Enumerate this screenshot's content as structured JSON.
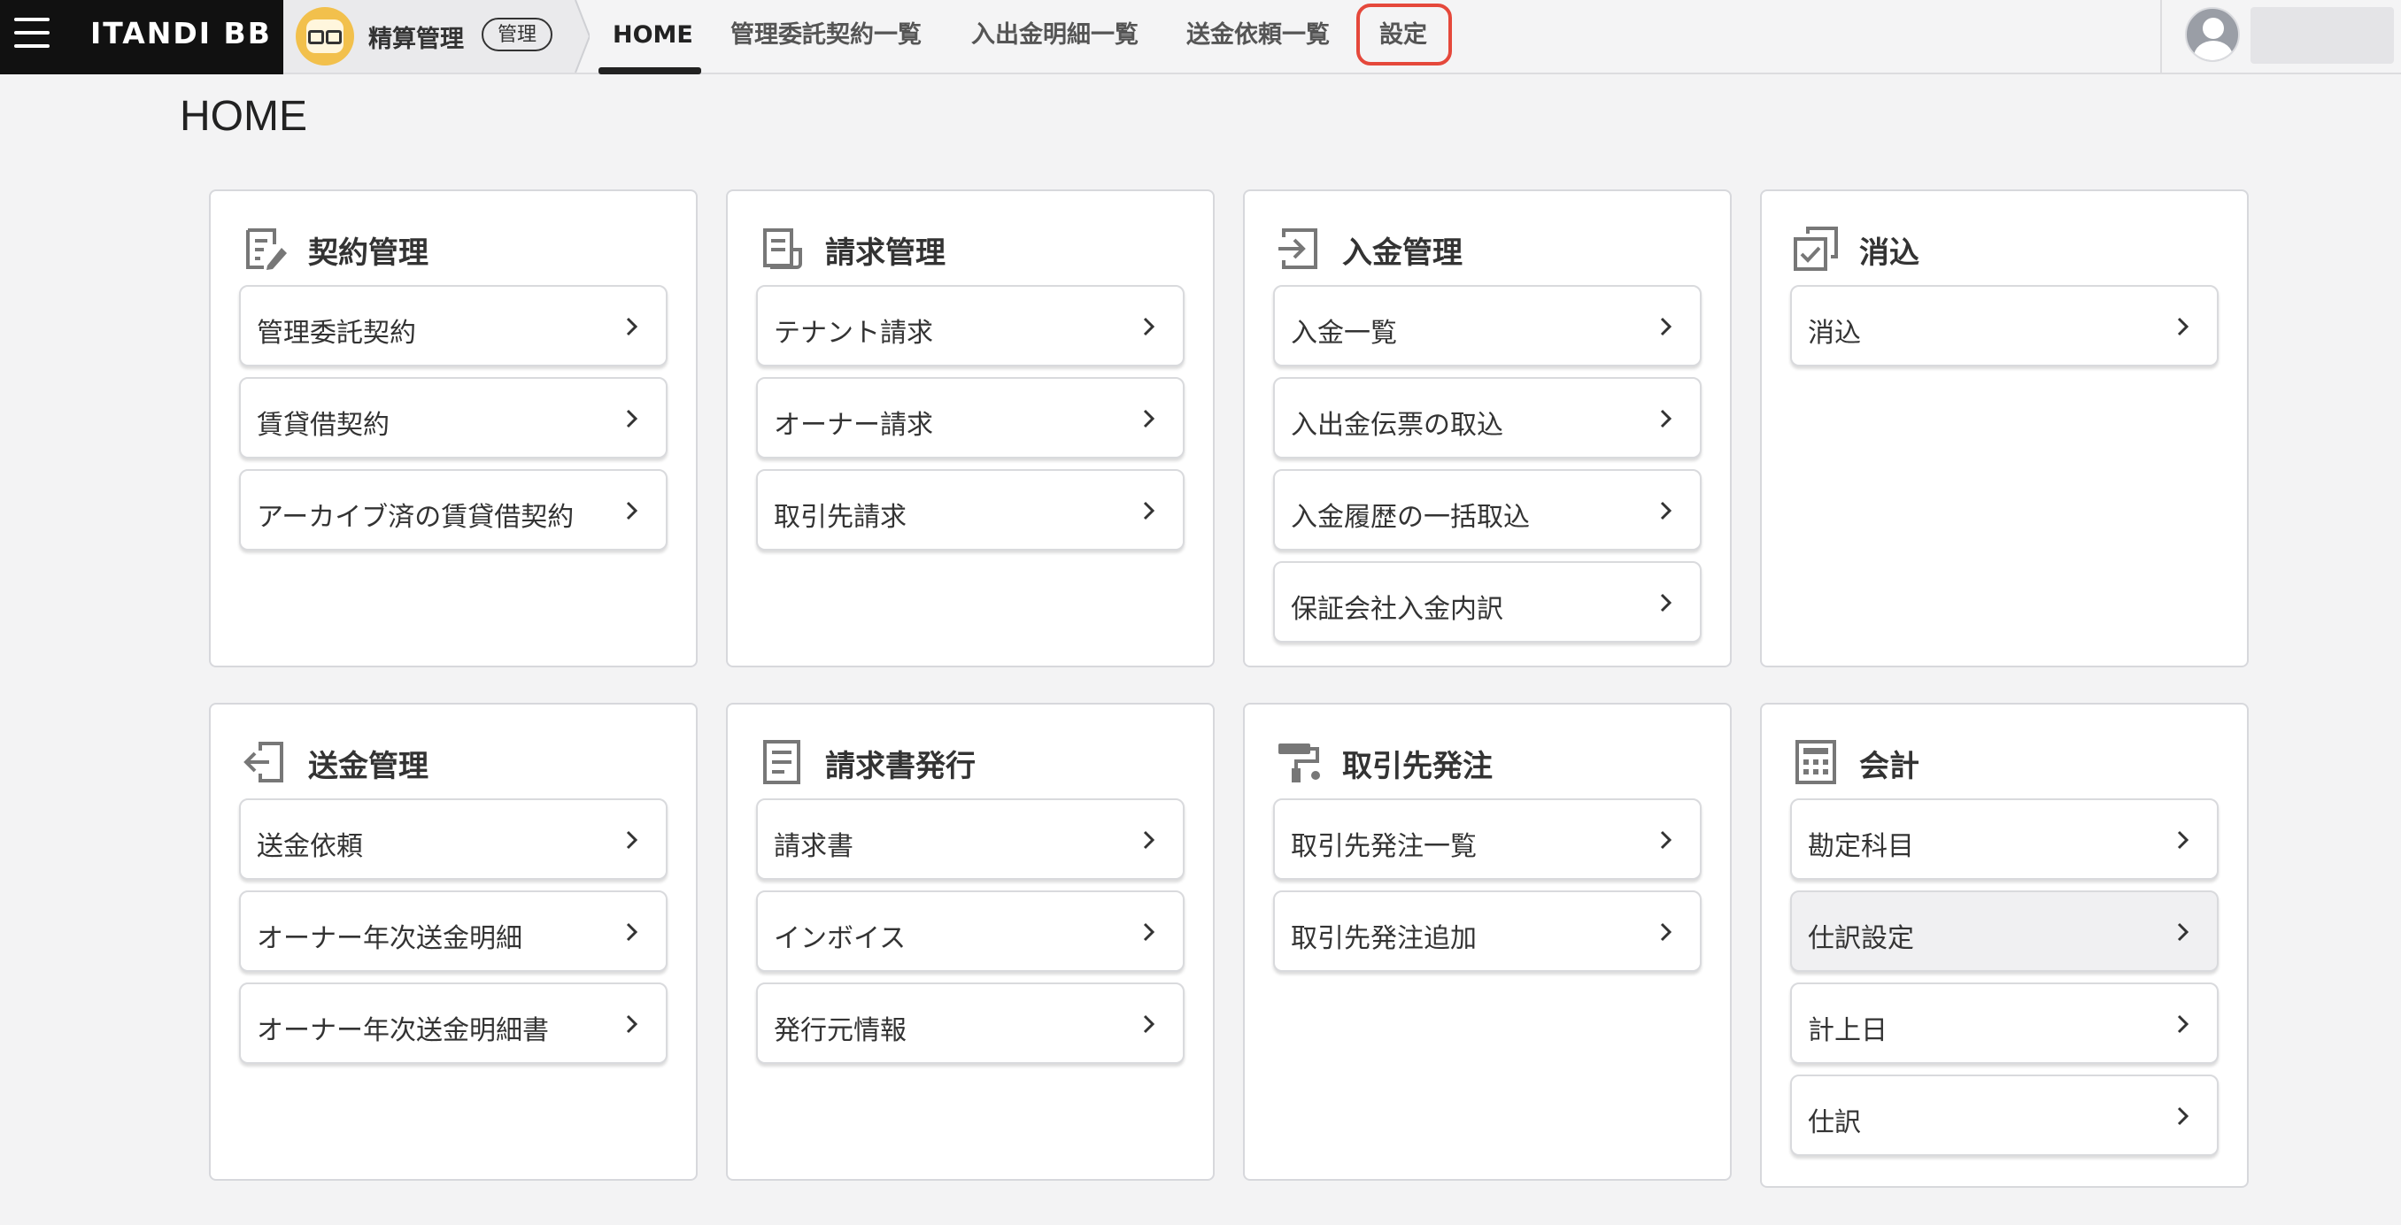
{
  "header": {
    "logo": "ITANDI BB",
    "app_name": "精算管理",
    "app_badge": "管理",
    "tabs": [
      {
        "label": "HOME",
        "active": true
      },
      {
        "label": "管理委託契約一覧"
      },
      {
        "label": "入出金明細一覧"
      },
      {
        "label": "送金依頼一覧"
      },
      {
        "label": "設定",
        "highlighted": true
      }
    ]
  },
  "page": {
    "title": "HOME"
  },
  "cards": [
    {
      "title": "契約管理",
      "icon": "contract-edit-icon",
      "items": [
        "管理委託契約",
        "賃貸借契約",
        "アーカイブ済の賃貸借契約"
      ]
    },
    {
      "title": "請求管理",
      "icon": "receipt-icon",
      "items": [
        "テナント請求",
        "オーナー請求",
        "取引先請求"
      ]
    },
    {
      "title": "入金管理",
      "icon": "login-arrow-icon",
      "items": [
        "入金一覧",
        "入出金伝票の取込",
        "入金履歴の一括取込",
        "保証会社入金内訳"
      ]
    },
    {
      "title": "消込",
      "icon": "check-stack-icon",
      "items": [
        "消込"
      ]
    },
    {
      "title": "送金管理",
      "icon": "logout-arrow-icon",
      "items": [
        "送金依頼",
        "オーナー年次送金明細",
        "オーナー年次送金明細書"
      ]
    },
    {
      "title": "請求書発行",
      "icon": "document-icon",
      "items": [
        "請求書",
        "インボイス",
        "発行元情報"
      ]
    },
    {
      "title": "取引先発注",
      "icon": "paint-roller-icon",
      "items": [
        "取引先発注一覧",
        "取引先発注追加"
      ]
    },
    {
      "title": "会計",
      "icon": "calculator-icon",
      "items": [
        "勘定科目",
        "仕訳設定",
        "計上日",
        "仕訳"
      ]
    }
  ],
  "colors": {
    "highlight": "#e5483b",
    "brand_bg": "#111111"
  }
}
